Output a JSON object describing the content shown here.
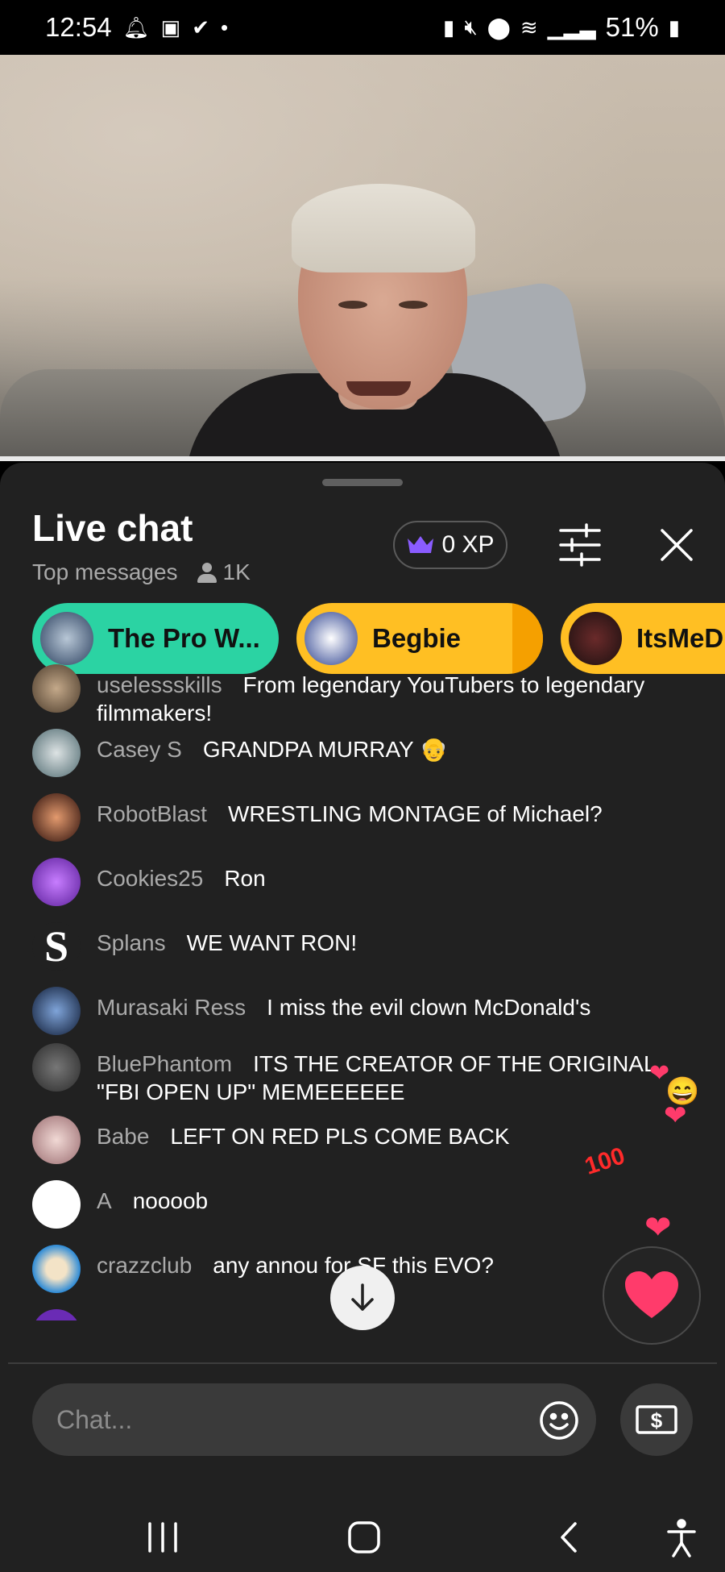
{
  "status_bar": {
    "time": "12:54",
    "battery": "51%",
    "left_icons": [
      "notification-bell-icon",
      "image-icon",
      "checkmark-icon",
      "dot-icon"
    ],
    "right_icons": [
      "battery-saver-icon",
      "mute-icon",
      "location-icon",
      "wifi-icon",
      "signal-icon",
      "battery-icon"
    ]
  },
  "chat_panel": {
    "title": "Live chat",
    "mode": "Top messages",
    "viewers": "1K",
    "xp": "0 XP"
  },
  "pinned": [
    {
      "name": "The Pro W...",
      "color": "#2bd3a3"
    },
    {
      "name": "Begbie",
      "color": "#ffbf23"
    },
    {
      "name": "ItsMeD",
      "color": "#ffbf23"
    }
  ],
  "messages": [
    {
      "author": "uselessskills",
      "text": "From legendary YouTubers to legendary filmmakers!",
      "avatar_color": "#6b5a44"
    },
    {
      "author": "Casey S",
      "text": "GRANDPA MURRAY 👴",
      "avatar_color": "#6f8a8e"
    },
    {
      "author": "RobotBlast",
      "text": "WRESTLING MONTAGE of Michael?",
      "avatar_color": "#5a2a22"
    },
    {
      "author": "Cookies25",
      "text": "Ron",
      "avatar_color": "#8f3fd6"
    },
    {
      "author": "Splans",
      "text": "WE WANT RON!",
      "avatar_color": "#212121"
    },
    {
      "author": "Murasaki Ress",
      "text": "I miss the evil clown McDonald's",
      "avatar_color": "#1f3b6e"
    },
    {
      "author": "BluePhantom",
      "text": "ITS THE CREATOR OF THE ORIGINAL \"FBI OPEN UP\" MEMEEEEEE",
      "avatar_color": "#3a3a3a"
    },
    {
      "author": "Babe",
      "text": "LEFT ON RED PLS COME BACK",
      "avatar_color": "#c9a7a9"
    },
    {
      "author": "A",
      "text": "noooob",
      "avatar_color": "#ffffff"
    },
    {
      "author": "crazzclub",
      "text": "any annou for SF this EVO?",
      "avatar_color": "#2e8bd6"
    }
  ],
  "input": {
    "placeholder": "Chat..."
  },
  "colors": {
    "panel_bg": "#212121",
    "accent_green": "#2bd3a3",
    "accent_yellow": "#ffbf23",
    "heart": "#ff3b6b",
    "crown": "#8a5cff"
  },
  "nav_icons": [
    "recent-apps-icon",
    "home-icon",
    "back-icon",
    "accessibility-icon"
  ]
}
